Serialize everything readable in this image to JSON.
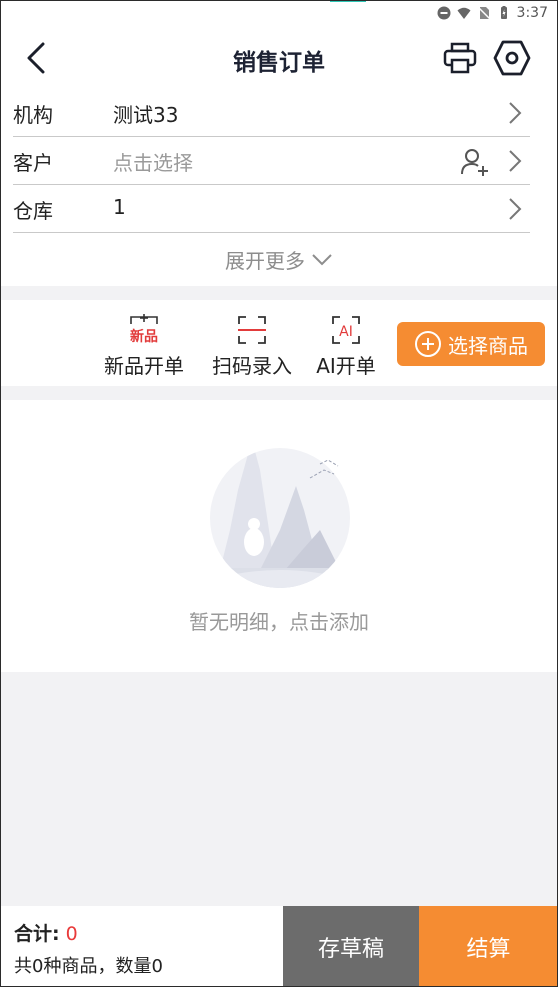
{
  "status_bar": {
    "time": "3:37"
  },
  "header": {
    "title": "销售订单"
  },
  "form": {
    "rows": [
      {
        "label": "机构",
        "value": "测试33",
        "placeholder": false
      },
      {
        "label": "客户",
        "value": "点击选择",
        "placeholder": true
      },
      {
        "label": "仓库",
        "value": "1",
        "placeholder": false
      }
    ],
    "expand_label": "展开更多"
  },
  "actions": {
    "new_product": {
      "icon_text": "新品",
      "label": "新品开单"
    },
    "scan": {
      "label": "扫码录入"
    },
    "ai": {
      "icon_text": "AI",
      "label": "AI开单"
    },
    "select_button": "选择商品"
  },
  "empty": {
    "text": "暂无明细，点击添加"
  },
  "footer": {
    "total_label": "合计:",
    "total_value": "0",
    "summary": "共0种商品，数量0",
    "draft_button": "存草稿",
    "checkout_button": "结算"
  },
  "colors": {
    "accent": "#f58c32",
    "draft": "#6c6c6c",
    "total_value": "#e93a3a",
    "icon_red": "#e23b3b"
  }
}
